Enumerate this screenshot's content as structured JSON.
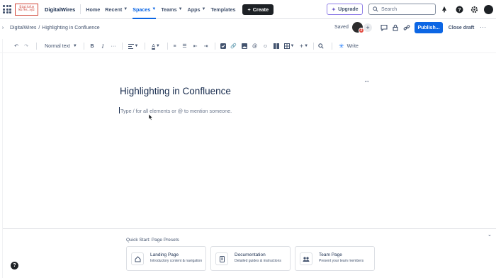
{
  "topnav": {
    "logo_lines": [
      "Digital@",
      "Wires.xyz"
    ],
    "site_name": "DigitalWires",
    "items": [
      {
        "label": "Home",
        "dropdown": false,
        "active": false
      },
      {
        "label": "Recent",
        "dropdown": true,
        "active": false
      },
      {
        "label": "Spaces",
        "dropdown": true,
        "active": true
      },
      {
        "label": "Teams",
        "dropdown": true,
        "active": false
      },
      {
        "label": "Apps",
        "dropdown": true,
        "active": false
      },
      {
        "label": "Templates",
        "dropdown": false,
        "active": false
      }
    ],
    "create_label": "Create",
    "upgrade_label": "Upgrade",
    "search_placeholder": "Search",
    "icons": [
      "notifications-icon",
      "help-icon",
      "settings-icon",
      "profile-avatar"
    ]
  },
  "breadcrumb": {
    "space": "DigitalWires",
    "separator": "/",
    "page": "Highlighting in Confluence"
  },
  "page_actions": {
    "saved_label": "Saved",
    "badge_text": "2",
    "publish_label": "Publish...",
    "close_draft_label": "Close draft",
    "more_label": "···"
  },
  "toolbar": {
    "text_style_label": "Normal text",
    "write_label": "Write"
  },
  "editor": {
    "title": "Highlighting in Confluence",
    "body_placeholder": "Type / for all elements or @ to mention someone."
  },
  "presets": {
    "title": "Quick Start: Page Presets",
    "cards": [
      {
        "name": "Landing Page",
        "description": "Introductory content & navigation",
        "icon": "home-icon"
      },
      {
        "name": "Documentation",
        "description": "Detailed guides & instructions",
        "icon": "document-icon"
      },
      {
        "name": "Team Page",
        "description": "Present your team members",
        "icon": "team-icon"
      }
    ]
  },
  "help_label": "?",
  "colors": {
    "accent": "#0c66e4",
    "create_bg": "#1d2125",
    "upgrade_border": "#8f7ee7",
    "badge": "#e2483d"
  }
}
